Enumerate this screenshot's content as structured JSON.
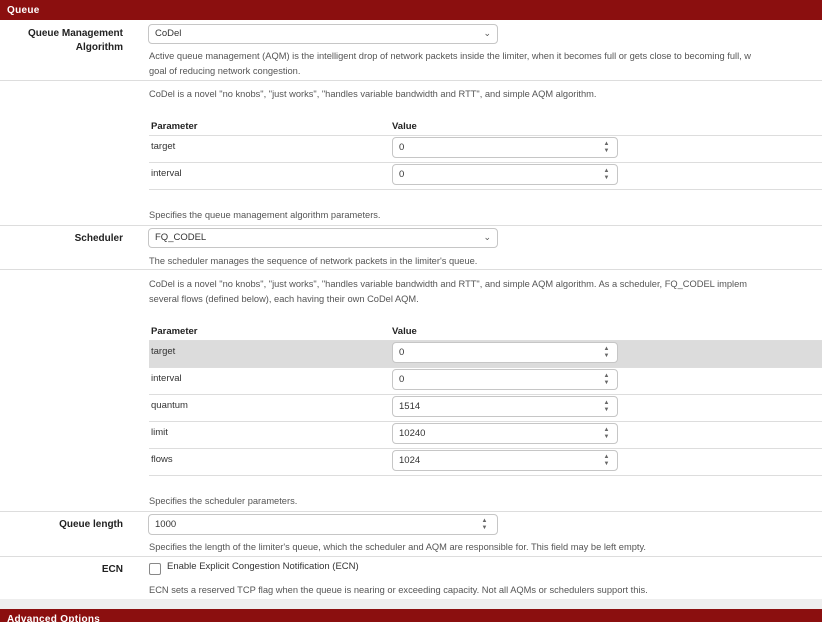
{
  "panel_title": "Queue",
  "advanced_title": "Advanced Options",
  "aqm": {
    "label": "Queue Management Algorithm",
    "selected": "CoDel",
    "help_1": "Active queue management (AQM) is the intelligent drop of network packets inside the limiter, when it becomes full or gets close to becoming full, w",
    "help_2": "goal of reducing network congestion.",
    "desc": "CoDel is a novel \"no knobs\", \"just works\", \"handles variable bandwidth and RTT\", and simple AQM algorithm.",
    "col_param": "Parameter",
    "col_value": "Value",
    "params": [
      {
        "name": "target",
        "value": "0"
      },
      {
        "name": "interval",
        "value": "0"
      }
    ],
    "params_help": "Specifies the queue management algorithm parameters."
  },
  "scheduler": {
    "label": "Scheduler",
    "selected": "FQ_CODEL",
    "help": "The scheduler manages the sequence of network packets in the limiter's queue.",
    "desc_1": "CoDel is a novel \"no knobs\", \"just works\", \"handles variable bandwidth and RTT\", and simple AQM algorithm. As a scheduler, FQ_CODEL implem",
    "desc_2": "several flows (defined below), each having their own CoDel AQM.",
    "col_param": "Parameter",
    "col_value": "Value",
    "params": [
      {
        "name": "target",
        "value": "0"
      },
      {
        "name": "interval",
        "value": "0"
      },
      {
        "name": "quantum",
        "value": "1514"
      },
      {
        "name": "limit",
        "value": "10240"
      },
      {
        "name": "flows",
        "value": "1024"
      }
    ],
    "params_help": "Specifies the scheduler parameters."
  },
  "queue_length": {
    "label": "Queue length",
    "value": "1000",
    "help": "Specifies the length of the limiter's queue, which the scheduler and AQM are responsible for. This field may be left empty."
  },
  "ecn": {
    "label": "ECN",
    "checkbox_label": "Enable Explicit Congestion Notification (ECN)",
    "help": "ECN sets a reserved TCP flag when the queue is nearing or exceeding capacity. Not all AQMs or schedulers support this."
  }
}
